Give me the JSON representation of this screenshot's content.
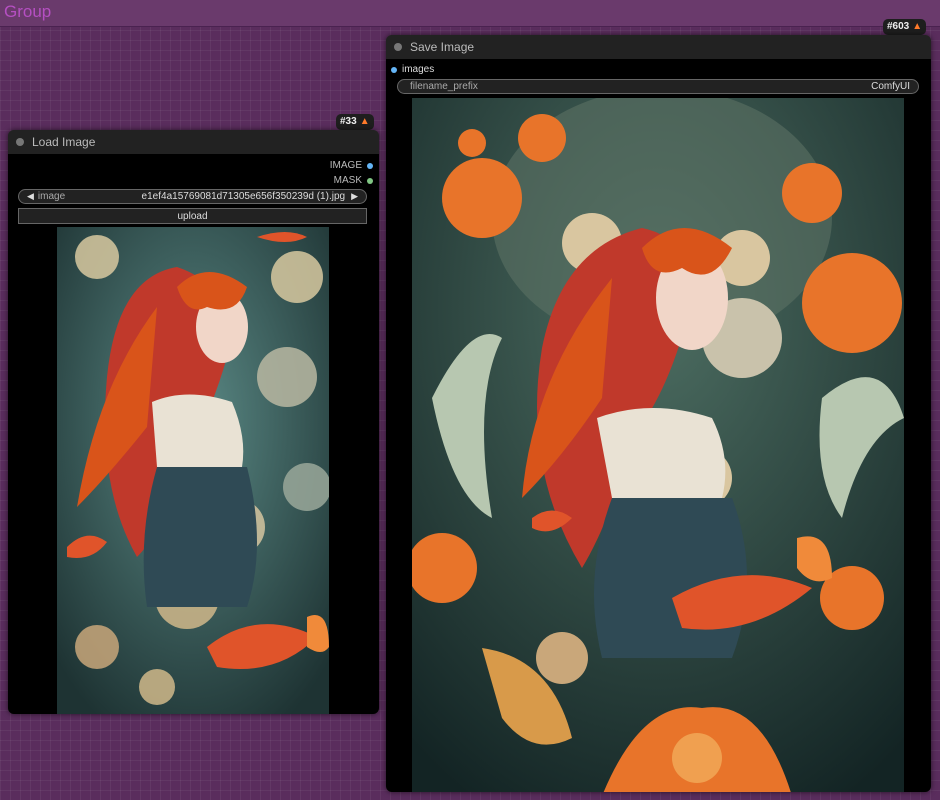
{
  "group": {
    "title": "Group"
  },
  "load_node": {
    "badge": "#33",
    "title": "Load Image",
    "outputs": [
      {
        "label": "IMAGE",
        "color": "#64b5f6"
      },
      {
        "label": "MASK",
        "color": "#81c784"
      }
    ],
    "image_widget": {
      "label": "image",
      "value": "e1ef4a15769081d71305e656f350239d (1).jpg"
    },
    "upload_label": "upload"
  },
  "save_node": {
    "badge": "#603",
    "title": "Save Image",
    "input": {
      "label": "images",
      "color": "#64b5f6"
    },
    "prefix_widget": {
      "label": "filename_prefix",
      "value": "ComfyUI"
    }
  },
  "icons": {
    "badge_icon": "fox-icon",
    "prev": "arrow-left-icon",
    "next": "arrow-right-icon"
  }
}
